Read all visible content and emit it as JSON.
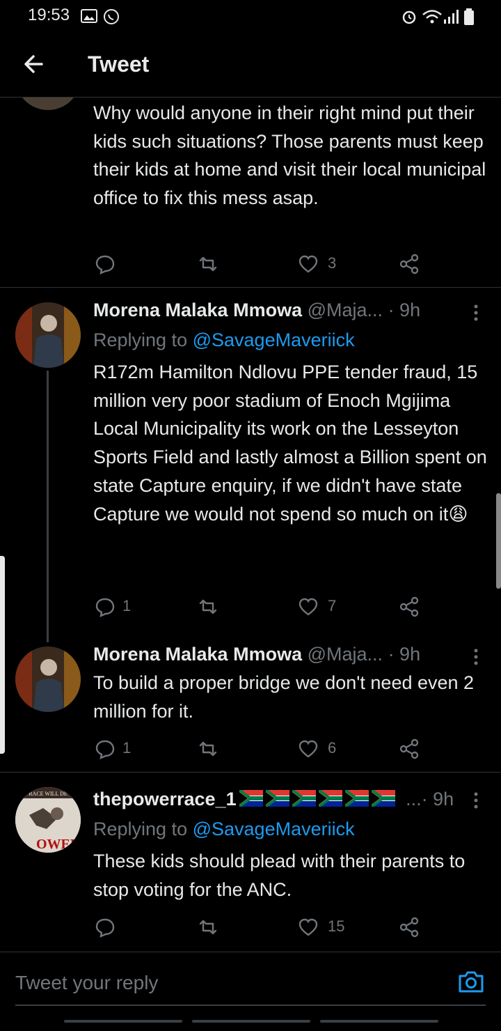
{
  "status_bar": {
    "time": "19:53",
    "icons": [
      "gallery-icon",
      "whatsapp-icon",
      "alarm-icon",
      "wifi-icon",
      "signal-icon",
      "battery-icon"
    ]
  },
  "header": {
    "title": "Tweet",
    "back_icon": "arrow-left-icon"
  },
  "tweets": [
    {
      "text": "Why would anyone in their right mind put their kids such situations? Those parents must keep their kids at home and visit their local municipal office to fix this mess asap.",
      "reply_count": "",
      "like_count": "3"
    },
    {
      "name": "Morena Malaka Mmowa",
      "handle": "@Maja...",
      "time": "· 9h",
      "replying_prefix": "Replying to",
      "replying_to": "@SavageMaveriick",
      "text": "R172m Hamilton Ndlovu PPE tender fraud, 15 million very poor stadium of Enoch Mgijima Local Municipality its work on the Lesseyton Sports Field and lastly almost a Billion spent on state Capture enquiry, if we didn't have state Capture we would not spend so much on it",
      "emoji": "😩",
      "reply_count": "1",
      "like_count": "7"
    },
    {
      "name": "Morena Malaka Mmowa",
      "handle": "@Maja...",
      "time": "· 9h",
      "text": "To build a proper bridge we don't need even 2 million for it.",
      "reply_count": "1",
      "like_count": "6"
    },
    {
      "name": "thepowerrace_1",
      "handle": "...",
      "time": "· 9h",
      "replying_prefix": "Replying to",
      "replying_to": "@SavageMaveriick",
      "text": "These kids should plead with their parents to stop voting for the ANC.",
      "reply_count": "",
      "like_count": "15",
      "avatar_text": "RACE WILL DE",
      "avatar_text2": "OWER"
    }
  ],
  "reply_bar": {
    "placeholder": "Tweet your reply",
    "camera_icon": "camera-icon"
  },
  "colors": {
    "background": "#000000",
    "text": "#e7e9ea",
    "muted": "#71767b",
    "accent": "#1d9bf0"
  }
}
